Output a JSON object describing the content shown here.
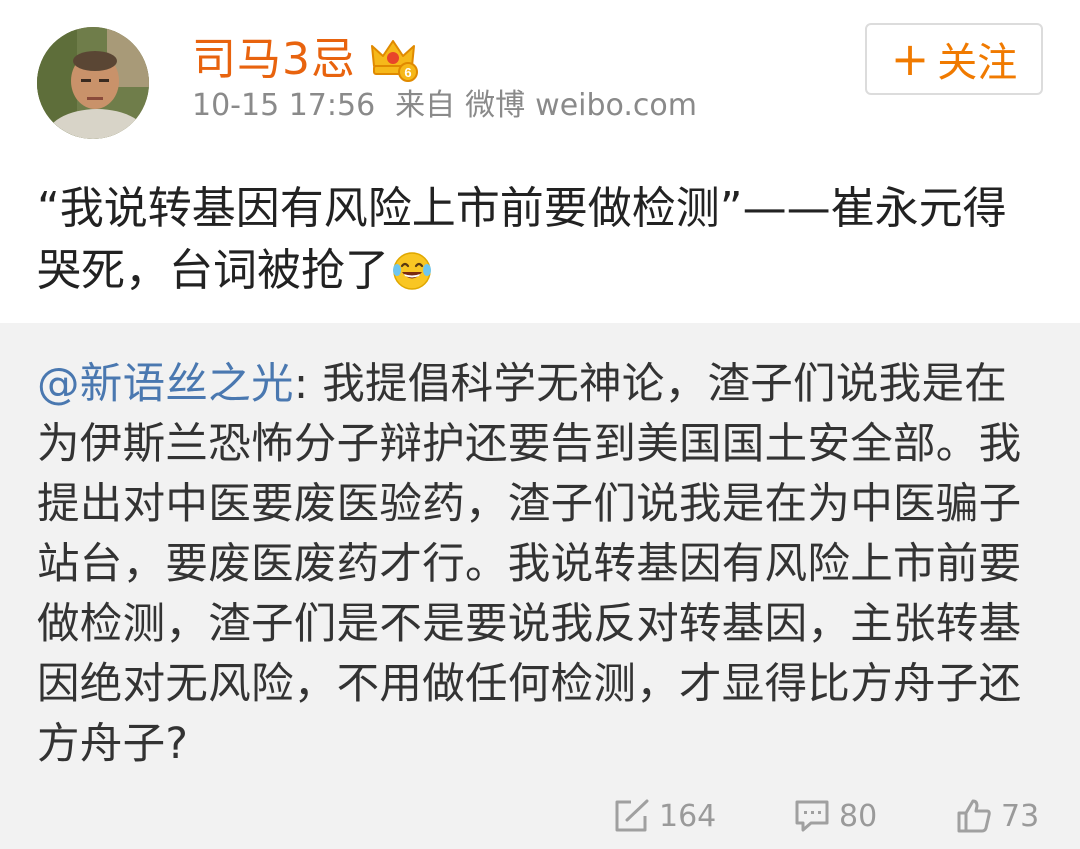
{
  "user": {
    "name": "司马3忌",
    "vip_badge_icon": "crown-vip-badge-icon",
    "vip_level": "6",
    "timestamp": "10-15 17:56",
    "source_prefix": "来自",
    "source_app": "微博",
    "source_domain": "weibo.com"
  },
  "follow_button": {
    "icon": "plus-icon",
    "plus_glyph": "+",
    "label": "关注",
    "color": "#f07a00"
  },
  "post": {
    "text": "“我说转基因有风险上市前要做检测”——崔永元得哭死，台词被抢了",
    "emoji": "laughing-tears-emoji"
  },
  "repost": {
    "mention": "@新语丝之光",
    "text": ": 我提倡科学无神论，渣子们说我是在为伊斯兰恐怖分子辩护还要告到美国国土安全部。我提出对中医要废医验药，渣子们说我是在为中医骗子站台，要废医废药才行。我说转基因有风险上市前要做检测，渣子们是不是要说我反对转基因，主张转基因绝对无风险，不用做任何检测，才显得比方舟子还方舟子?",
    "mention_color": "#4a78b0"
  },
  "actions": {
    "repost_count": "164",
    "comment_count": "80",
    "like_count": "73"
  },
  "colors": {
    "username": "#e8630e",
    "meta": "#8a8a8a",
    "repost_bg": "#f2f2f2"
  }
}
